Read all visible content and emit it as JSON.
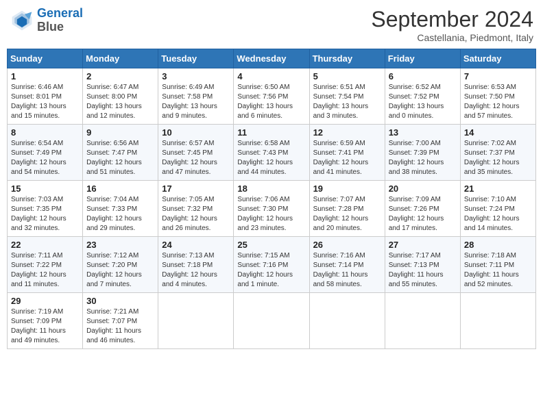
{
  "header": {
    "logo_line1": "General",
    "logo_line2": "Blue",
    "month_title": "September 2024",
    "location": "Castellania, Piedmont, Italy"
  },
  "weekdays": [
    "Sunday",
    "Monday",
    "Tuesday",
    "Wednesday",
    "Thursday",
    "Friday",
    "Saturday"
  ],
  "weeks": [
    [
      {
        "day": "1",
        "sunrise": "6:46 AM",
        "sunset": "8:01 PM",
        "daylight": "13 hours and 15 minutes."
      },
      {
        "day": "2",
        "sunrise": "6:47 AM",
        "sunset": "8:00 PM",
        "daylight": "13 hours and 12 minutes."
      },
      {
        "day": "3",
        "sunrise": "6:49 AM",
        "sunset": "7:58 PM",
        "daylight": "13 hours and 9 minutes."
      },
      {
        "day": "4",
        "sunrise": "6:50 AM",
        "sunset": "7:56 PM",
        "daylight": "13 hours and 6 minutes."
      },
      {
        "day": "5",
        "sunrise": "6:51 AM",
        "sunset": "7:54 PM",
        "daylight": "13 hours and 3 minutes."
      },
      {
        "day": "6",
        "sunrise": "6:52 AM",
        "sunset": "7:52 PM",
        "daylight": "13 hours and 0 minutes."
      },
      {
        "day": "7",
        "sunrise": "6:53 AM",
        "sunset": "7:50 PM",
        "daylight": "12 hours and 57 minutes."
      }
    ],
    [
      {
        "day": "8",
        "sunrise": "6:54 AM",
        "sunset": "7:49 PM",
        "daylight": "12 hours and 54 minutes."
      },
      {
        "day": "9",
        "sunrise": "6:56 AM",
        "sunset": "7:47 PM",
        "daylight": "12 hours and 51 minutes."
      },
      {
        "day": "10",
        "sunrise": "6:57 AM",
        "sunset": "7:45 PM",
        "daylight": "12 hours and 47 minutes."
      },
      {
        "day": "11",
        "sunrise": "6:58 AM",
        "sunset": "7:43 PM",
        "daylight": "12 hours and 44 minutes."
      },
      {
        "day": "12",
        "sunrise": "6:59 AM",
        "sunset": "7:41 PM",
        "daylight": "12 hours and 41 minutes."
      },
      {
        "day": "13",
        "sunrise": "7:00 AM",
        "sunset": "7:39 PM",
        "daylight": "12 hours and 38 minutes."
      },
      {
        "day": "14",
        "sunrise": "7:02 AM",
        "sunset": "7:37 PM",
        "daylight": "12 hours and 35 minutes."
      }
    ],
    [
      {
        "day": "15",
        "sunrise": "7:03 AM",
        "sunset": "7:35 PM",
        "daylight": "12 hours and 32 minutes."
      },
      {
        "day": "16",
        "sunrise": "7:04 AM",
        "sunset": "7:33 PM",
        "daylight": "12 hours and 29 minutes."
      },
      {
        "day": "17",
        "sunrise": "7:05 AM",
        "sunset": "7:32 PM",
        "daylight": "12 hours and 26 minutes."
      },
      {
        "day": "18",
        "sunrise": "7:06 AM",
        "sunset": "7:30 PM",
        "daylight": "12 hours and 23 minutes."
      },
      {
        "day": "19",
        "sunrise": "7:07 AM",
        "sunset": "7:28 PM",
        "daylight": "12 hours and 20 minutes."
      },
      {
        "day": "20",
        "sunrise": "7:09 AM",
        "sunset": "7:26 PM",
        "daylight": "12 hours and 17 minutes."
      },
      {
        "day": "21",
        "sunrise": "7:10 AM",
        "sunset": "7:24 PM",
        "daylight": "12 hours and 14 minutes."
      }
    ],
    [
      {
        "day": "22",
        "sunrise": "7:11 AM",
        "sunset": "7:22 PM",
        "daylight": "12 hours and 11 minutes."
      },
      {
        "day": "23",
        "sunrise": "7:12 AM",
        "sunset": "7:20 PM",
        "daylight": "12 hours and 7 minutes."
      },
      {
        "day": "24",
        "sunrise": "7:13 AM",
        "sunset": "7:18 PM",
        "daylight": "12 hours and 4 minutes."
      },
      {
        "day": "25",
        "sunrise": "7:15 AM",
        "sunset": "7:16 PM",
        "daylight": "12 hours and 1 minute."
      },
      {
        "day": "26",
        "sunrise": "7:16 AM",
        "sunset": "7:14 PM",
        "daylight": "11 hours and 58 minutes."
      },
      {
        "day": "27",
        "sunrise": "7:17 AM",
        "sunset": "7:13 PM",
        "daylight": "11 hours and 55 minutes."
      },
      {
        "day": "28",
        "sunrise": "7:18 AM",
        "sunset": "7:11 PM",
        "daylight": "11 hours and 52 minutes."
      }
    ],
    [
      {
        "day": "29",
        "sunrise": "7:19 AM",
        "sunset": "7:09 PM",
        "daylight": "11 hours and 49 minutes."
      },
      {
        "day": "30",
        "sunrise": "7:21 AM",
        "sunset": "7:07 PM",
        "daylight": "11 hours and 46 minutes."
      },
      null,
      null,
      null,
      null,
      null
    ]
  ]
}
